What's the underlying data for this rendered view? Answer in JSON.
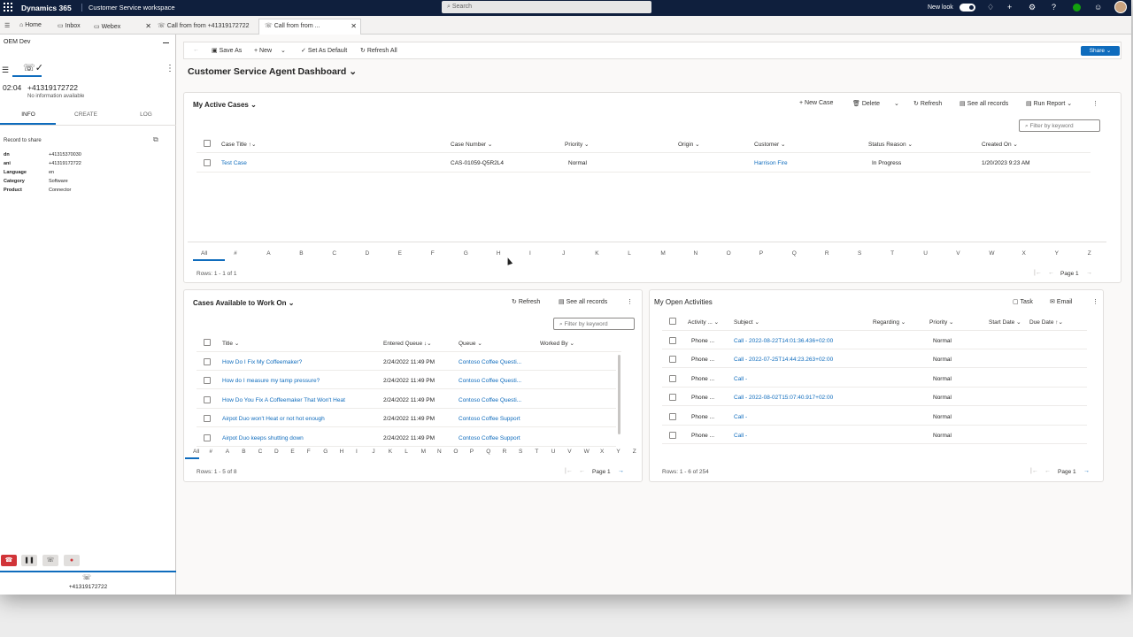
{
  "topbar": {
    "app": "Dynamics 365",
    "workspace": "Customer Service workspace",
    "search_placeholder": "Search",
    "newlook": "New look"
  },
  "tabs": {
    "home": "Home",
    "inbox": "Inbox",
    "webex": "Webex",
    "tab1": "Call from from +41319172722",
    "tab2": "Call from from ..."
  },
  "left": {
    "env": "OEM Dev",
    "call_time": "02:04",
    "call_number": "+41319172722",
    "no_info": "No information available",
    "tabs": [
      "INFO",
      "CREATE",
      "LOG"
    ],
    "record_to_share": "Record to share",
    "fields": [
      {
        "k": "dn",
        "v": "+41315370030"
      },
      {
        "k": "ani",
        "v": "+41319172722"
      },
      {
        "k": "Language",
        "v": "en"
      },
      {
        "k": "Category",
        "v": "Software"
      },
      {
        "k": "Product",
        "v": "Connector"
      }
    ],
    "bottom_number": "+41319172722"
  },
  "cmdbar": {
    "save_as": "Save As",
    "new": "New",
    "set_default": "Set As Default",
    "refresh_all": "Refresh All",
    "share": "Share"
  },
  "dashboard_title": "Customer Service Agent Dashboard",
  "active_cases": {
    "title": "My Active Cases",
    "new_case": "New Case",
    "delete": "Delete",
    "refresh": "Refresh",
    "see_all": "See all records",
    "run_report": "Run Report",
    "filter": "Filter by keyword",
    "headers": [
      "Case Title",
      "Case Number",
      "Priority",
      "Origin",
      "Customer",
      "Status Reason",
      "Created On"
    ],
    "row": {
      "title": "Test Case",
      "number": "CAS-01059-Q5R2L4",
      "priority": "Normal",
      "origin": "",
      "customer": "Harrison Fire",
      "status": "In Progress",
      "created": "1/20/2023 9:23 AM"
    },
    "rows_text": "Rows: 1 - 1 of 1",
    "page": "Page 1"
  },
  "alphabet": [
    "All",
    "#",
    "A",
    "B",
    "C",
    "D",
    "E",
    "F",
    "G",
    "H",
    "I",
    "J",
    "K",
    "L",
    "M",
    "N",
    "O",
    "P",
    "Q",
    "R",
    "S",
    "T",
    "U",
    "V",
    "W",
    "X",
    "Y",
    "Z"
  ],
  "available": {
    "title": "Cases Available to Work On",
    "refresh": "Refresh",
    "see_all": "See all records",
    "filter": "Filter by keyword",
    "headers": [
      "Title",
      "Entered Queue",
      "Queue",
      "Worked By"
    ],
    "rows": [
      {
        "title": "How Do I Fix My Coffeemaker?",
        "entered": "2/24/2022 11:49 PM",
        "queue": "Contoso Coffee Questi..."
      },
      {
        "title": "How do I measure my tamp pressure?",
        "entered": "2/24/2022 11:49 PM",
        "queue": "Contoso Coffee Questi..."
      },
      {
        "title": "How Do You Fix A Coffeemaker That Won't Heat",
        "entered": "2/24/2022 11:49 PM",
        "queue": "Contoso Coffee Questi..."
      },
      {
        "title": "Airpot Duo won't Heat or not hot enough",
        "entered": "2/24/2022 11:49 PM",
        "queue": "Contoso Coffee Support"
      },
      {
        "title": "Airpot Duo keeps shutting down",
        "entered": "2/24/2022 11:49 PM",
        "queue": "Contoso Coffee Support"
      }
    ],
    "rows_text": "Rows: 1 - 5 of 8",
    "page": "Page 1"
  },
  "activities": {
    "title": "My Open Activities",
    "task": "Task",
    "email": "Email",
    "headers": [
      "Activity ...",
      "Subject",
      "Regarding",
      "Priority",
      "Start Date",
      "Due Date"
    ],
    "rows": [
      {
        "type": "Phone ...",
        "subject": "Call - 2022-08-22T14:01:36.436+02:00",
        "priority": "Normal"
      },
      {
        "type": "Phone ...",
        "subject": "Call - 2022-07-25T14:44:23.263+02:00",
        "priority": "Normal"
      },
      {
        "type": "Phone ...",
        "subject": "Call -",
        "priority": "Normal"
      },
      {
        "type": "Phone ...",
        "subject": "Call - 2022-08-02T15:07:40.917+02:00",
        "priority": "Normal"
      },
      {
        "type": "Phone ...",
        "subject": "Call -",
        "priority": "Normal"
      },
      {
        "type": "Phone ...",
        "subject": "Call -",
        "priority": "Normal"
      }
    ],
    "rows_text": "Rows: 1 - 6 of 254",
    "page": "Page 1"
  }
}
